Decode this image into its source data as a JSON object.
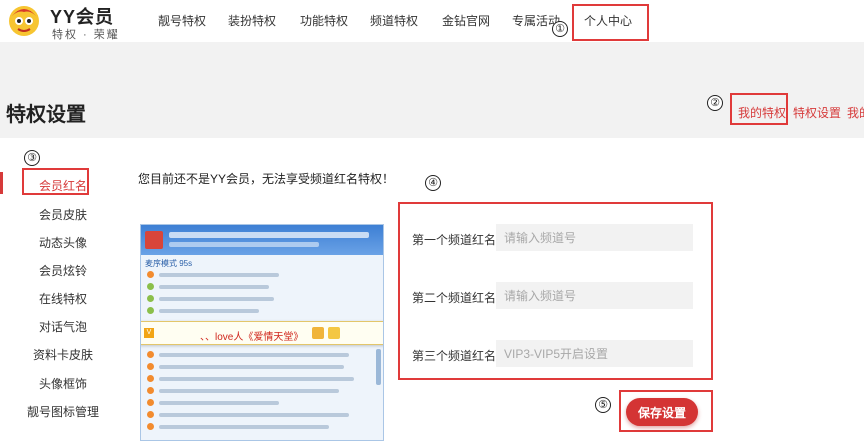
{
  "logo": {
    "title": "YY会员",
    "subtitle": "特权 · 荣耀"
  },
  "nav": {
    "items": [
      "靓号特权",
      "装扮特权",
      "功能特权",
      "频道特权",
      "金钻官网",
      "专属活动",
      "个人中心"
    ]
  },
  "annotations": [
    "①",
    "②",
    "③",
    "④",
    "⑤"
  ],
  "page": {
    "title": "特权设置"
  },
  "tabs": [
    "我的特权",
    "特权设置",
    "我的"
  ],
  "sidebar": {
    "items": [
      "会员红名",
      "会员皮肤",
      "动态头像",
      "会员炫铃",
      "在线特权",
      "对话气泡",
      "资料卡皮肤",
      "头像框饰",
      "靓号图标管理"
    ]
  },
  "notice": "您目前还不是YY会员，无法享受频道红名特权！",
  "preview": {
    "mode_text": "麦序模式 95s",
    "highlight_text": "、、love人《爱情天堂》"
  },
  "form": {
    "fields": [
      {
        "label": "第一个频道红名",
        "placeholder": "请输入频道号"
      },
      {
        "label": "第二个频道红名",
        "placeholder": "请输入频道号"
      },
      {
        "label": "第三个频道红名",
        "placeholder": "VIP3-VIP5开启设置"
      }
    ],
    "save_label": "保存设置"
  },
  "colors": {
    "accent": "#d43434",
    "annotation": "#e03a3a"
  }
}
